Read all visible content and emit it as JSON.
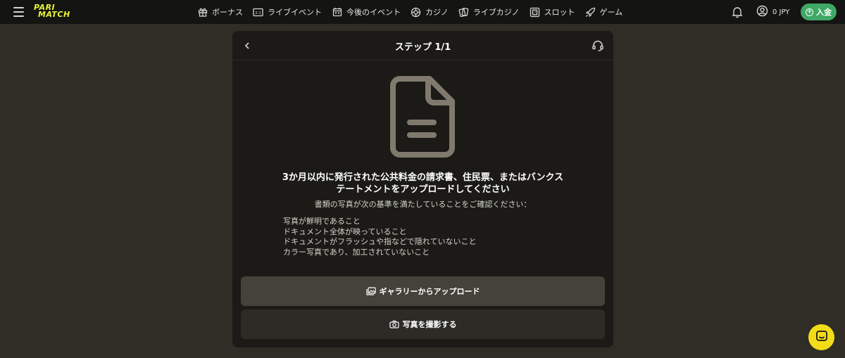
{
  "logo": {
    "line1": "PARI",
    "line2": "MATCH"
  },
  "nav": [
    {
      "label": "ボーナス",
      "icon": "gift-icon"
    },
    {
      "label": "ライブイベント",
      "icon": "scoreboard-icon"
    },
    {
      "label": "今後のイベント",
      "icon": "calendar-icon"
    },
    {
      "label": "カジノ",
      "icon": "roulette-icon"
    },
    {
      "label": "ライブカジノ",
      "icon": "cards-icon"
    },
    {
      "label": "スロット",
      "icon": "slot-icon"
    },
    {
      "label": "ゲーム",
      "icon": "rocket-icon"
    }
  ],
  "account": {
    "balance": "0 JPY"
  },
  "deposit": {
    "label": "入金"
  },
  "modal": {
    "title": "ステップ 1/1",
    "heading_line1": "3か月以内に発行された公共料金の請求書、住民票、またはバンクス",
    "heading_line2": "テートメントをアップロードしてください",
    "subtitle": "書類の写真が次の基準を満たしていることをご確認ください：",
    "criteria": [
      "写真が鮮明であること",
      "ドキュメント全体が映っていること",
      "ドキュメントがフラッシュや指などで隠れていないこと",
      "カラー写真であり、加工されていないこと"
    ],
    "gallery_button": "ギャラリーからアップロード",
    "camera_button": "写真を撮影する"
  },
  "colors": {
    "accent_green": "#3fa866",
    "logo_yellow": "#e8f53a",
    "chat_yellow": "#f2dc17",
    "background": "#2f2d26"
  }
}
